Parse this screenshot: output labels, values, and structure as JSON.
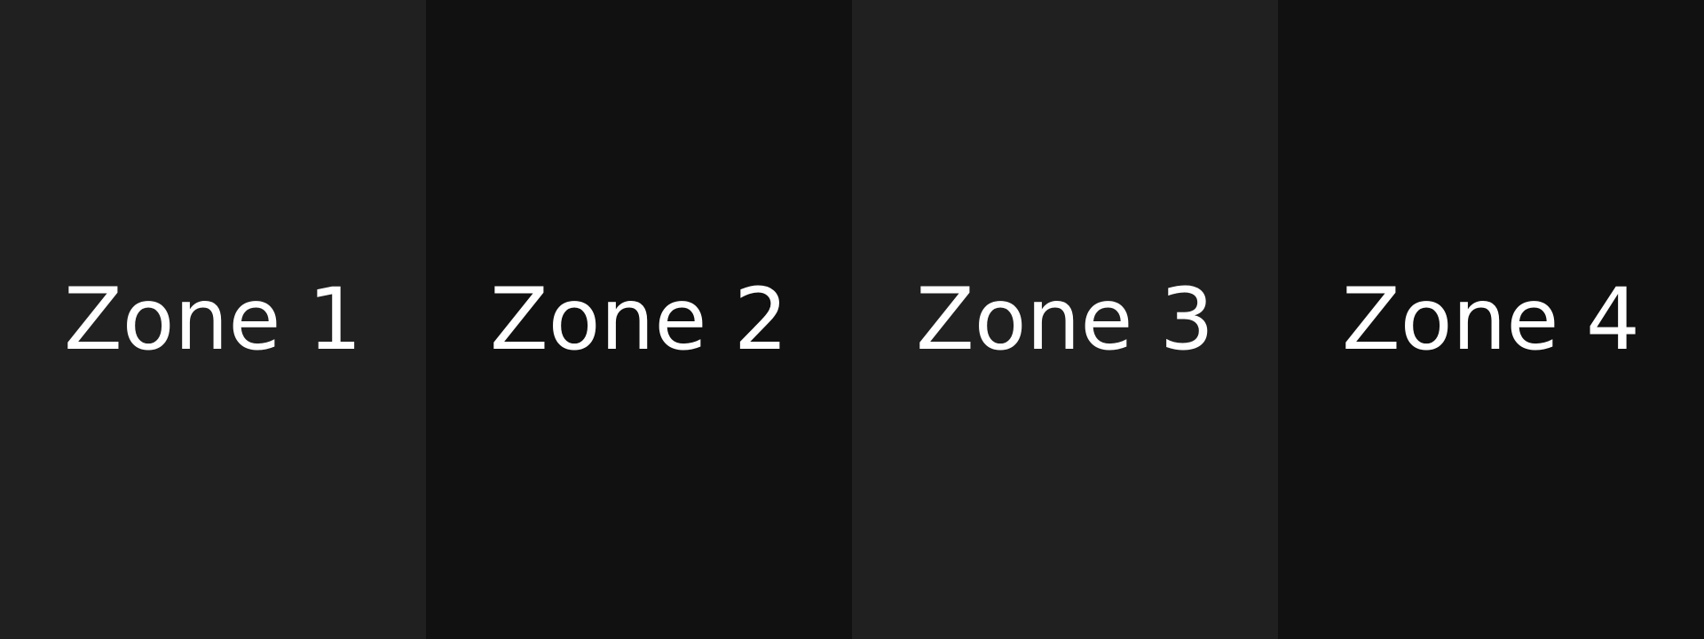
{
  "zones": [
    {
      "label": "Zone 1",
      "background": "#202020"
    },
    {
      "label": "Zone 2",
      "background": "#111111"
    },
    {
      "label": "Zone 3",
      "background": "#202020"
    },
    {
      "label": "Zone 4",
      "background": "#111111"
    }
  ],
  "colors": {
    "text": "#ffffff"
  }
}
